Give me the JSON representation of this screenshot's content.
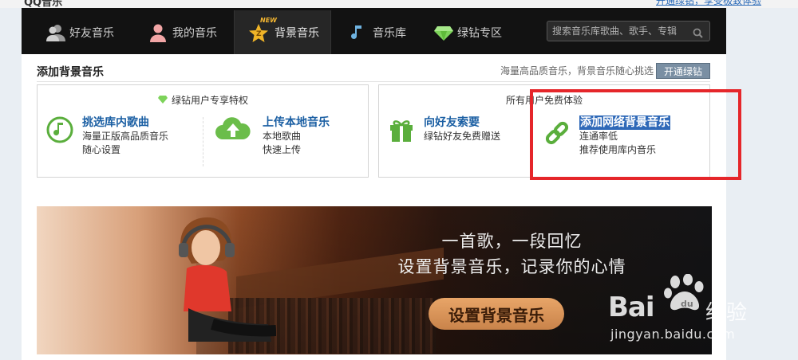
{
  "top": {
    "app_title": "QQ音乐",
    "top_link": "开通绿钻，享受极致体验"
  },
  "nav": {
    "items": [
      {
        "label": "好友音乐",
        "icon": "friends-icon"
      },
      {
        "label": "我的音乐",
        "icon": "person-icon"
      },
      {
        "label": "背景音乐",
        "icon": "star-icon",
        "badge": "NEW",
        "active": true
      },
      {
        "label": "音乐库",
        "icon": "music-note-icon"
      },
      {
        "label": "绿钻专区",
        "icon": "diamond-icon"
      }
    ],
    "search_placeholder": "搜索音乐库歌曲、歌手、专辑"
  },
  "section": {
    "title": "添加背景音乐",
    "promo": "海量高品质音乐，背景音乐随心挑选",
    "open_button": "开通绿钻"
  },
  "vip_box": {
    "header": "绿钻用户专享特权",
    "items": [
      {
        "title": "挑选库内歌曲",
        "desc1": "海量正版高品质音乐",
        "desc2": "随心设置",
        "icon": "music-circle-icon"
      },
      {
        "title": "上传本地音乐",
        "desc1": "本地歌曲",
        "desc2": "快速上传",
        "icon": "cloud-upload-icon"
      }
    ]
  },
  "free_box": {
    "header": "所有用户免费体验",
    "items": [
      {
        "title": "向好友索要",
        "desc1": "绿钻好友免费赠送",
        "desc2": "",
        "icon": "gift-icon"
      },
      {
        "title": "添加网络背景音乐",
        "desc1": "连通率低",
        "desc2": "推荐使用库内音乐",
        "icon": "link-icon"
      }
    ]
  },
  "banner": {
    "line1": "一首歌，一段回忆",
    "line2": "设置背景音乐，记录你的心情",
    "button": "设置背景音乐"
  },
  "watermark": {
    "brand": "Bai",
    "brand2": "经验",
    "url": "jingyan.baidu.com"
  },
  "colors": {
    "nav_bg": "#121212",
    "link_blue": "#1b5fa3",
    "green": "#5aae3c",
    "highlight": "#e5262a"
  }
}
